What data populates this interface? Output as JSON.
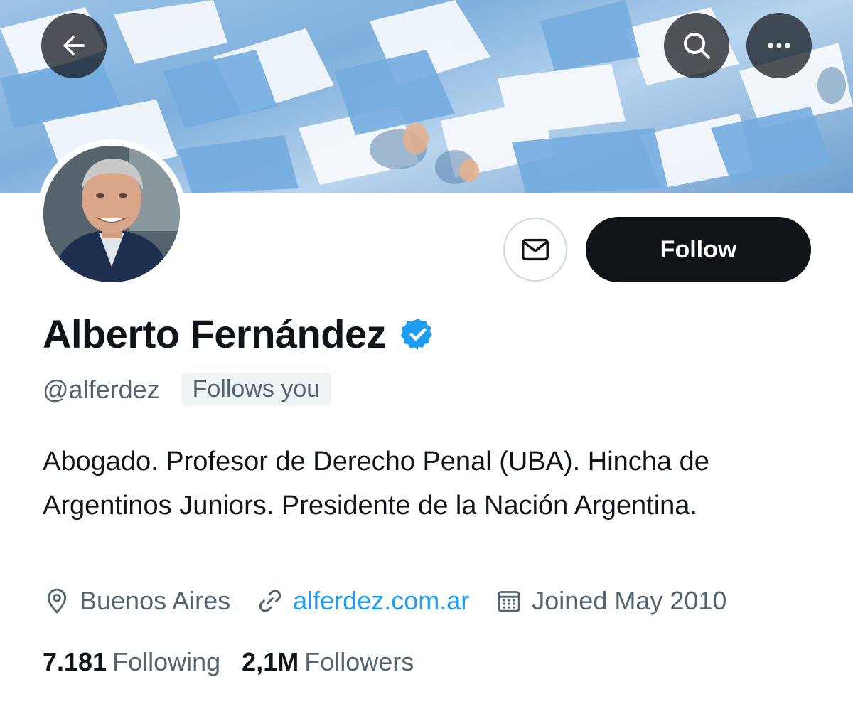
{
  "header": {
    "back_icon": "arrow-left-icon",
    "search_icon": "search-icon",
    "more_icon": "more-dots-icon",
    "banner_colors": [
      "#74acdf",
      "#ffffff"
    ]
  },
  "profile": {
    "name": "Alberto Fernández",
    "handle": "@alferdez",
    "follows_you": "Follows you",
    "bio": "Abogado. Profesor de Derecho Penal (UBA). Hincha de Argentinos Juniors. Presidente de la Nación Argentina.",
    "location": "Buenos Aires",
    "website": "alferdez.com.ar",
    "joined": "Joined May 2010",
    "following_count": "7.181",
    "following_label": "Following",
    "followers_count": "2,1M",
    "followers_label": "Followers"
  },
  "actions": {
    "follow_label": "Follow",
    "message_icon": "mail-icon"
  },
  "colors": {
    "accent": "#1d9bf0",
    "verified": "#1d9bf0",
    "text_primary": "#0f1419",
    "text_secondary": "#536471"
  }
}
